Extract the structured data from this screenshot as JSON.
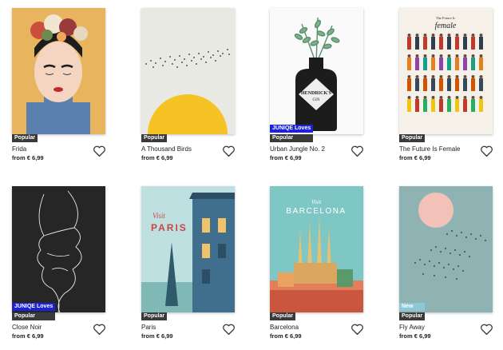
{
  "products": [
    {
      "title": "Frida",
      "price": "from € 6,99",
      "badges": [
        "Popular"
      ]
    },
    {
      "title": "A Thousand Birds",
      "price": "from € 6,99",
      "badges": [
        "Popular"
      ]
    },
    {
      "title": "Urban Jungle No. 2",
      "price": "from € 6,99",
      "badges": [
        "JUNIQE Loves",
        "Popular"
      ]
    },
    {
      "title": "The Future Is Female",
      "price": "from € 6,99",
      "badges": [
        "Popular"
      ]
    },
    {
      "title": "Close Noir",
      "price": "from € 6,99",
      "badges": [
        "JUNIQE Loves",
        "Popular"
      ]
    },
    {
      "title": "Paris",
      "price": "from € 6,99",
      "badges": [
        "Popular"
      ]
    },
    {
      "title": "Barcelona",
      "price": "from € 6,99",
      "badges": [
        "Popular"
      ]
    },
    {
      "title": "Fly Away",
      "price": "from € 6,99",
      "badges": [
        "New",
        "Popular"
      ]
    }
  ],
  "poster_text": {
    "urban_jungle_label": "HENDRICK'S",
    "urban_jungle_sub": "GIN",
    "future_header": "The Future Is",
    "future_script": "female",
    "paris_visit": "Visit",
    "paris_city": "PARIS",
    "barcelona_visit": "Visit",
    "barcelona_city": "BARCELONA"
  },
  "icons": {
    "favorite": "heart-outline-icon"
  },
  "colors": {
    "popular_badge": "#3a3a3a",
    "loves_badge": "#1e22d6",
    "new_badge": "#8fc7d6"
  }
}
